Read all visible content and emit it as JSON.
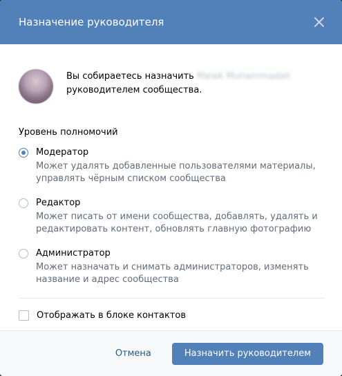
{
  "dialog": {
    "title": "Назначение руководителя"
  },
  "intro": {
    "prefix": "Вы собираетесь назначить",
    "name": "Malak Muhammadali",
    "suffix": "руководителем сообщества."
  },
  "permissions": {
    "label": "Уровень полномочий",
    "options": [
      {
        "title": "Модератор",
        "description": "Может удалять добавленные пользователями материалы, управлять чёрным списком сообщества",
        "selected": true
      },
      {
        "title": "Редактор",
        "description": "Может писать от имени сообщества, добавлять, удалять и редактировать контент, обновлять главную фотографию",
        "selected": false
      },
      {
        "title": "Администратор",
        "description": "Может назначать и снимать администраторов, изменять название и адрес сообщества",
        "selected": false
      }
    ]
  },
  "contacts_checkbox": {
    "label": "Отображать в блоке контактов",
    "checked": false
  },
  "footer": {
    "cancel_label": "Отмена",
    "submit_label": "Назначить руководителем"
  },
  "colors": {
    "accent": "#5181b8",
    "link": "#2a5885",
    "muted_text": "#626d7a"
  },
  "icons": {
    "close": "close-icon"
  }
}
